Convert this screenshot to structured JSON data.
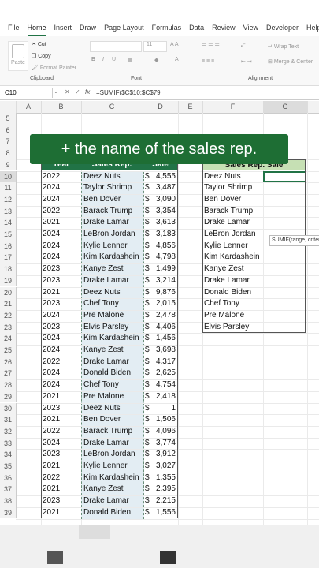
{
  "menu": [
    "File",
    "Home",
    "Insert",
    "Draw",
    "Page Layout",
    "Formulas",
    "Data",
    "Review",
    "View",
    "Developer",
    "Help"
  ],
  "ribbon": {
    "paste": "Paste",
    "cut": "Cut",
    "copy": "Copy",
    "format_painter": "Format Painter",
    "clipboard": "Clipboard",
    "font": "Font",
    "alignment": "Alignment",
    "wrap_text": "Wrap Text",
    "merge_center": "Merge & Center",
    "font_size": "11"
  },
  "formula_bar": {
    "name_box": "C10",
    "fx": "fx",
    "formula": "=SUMIF($C$10:$C$79"
  },
  "columns": [
    "A",
    "B",
    "C",
    "D",
    "E",
    "F",
    "G"
  ],
  "rows": [
    "5",
    "6",
    "7",
    "8",
    "9",
    "10",
    "11",
    "12",
    "13",
    "14",
    "15",
    "16",
    "17",
    "18",
    "19",
    "20",
    "21",
    "22",
    "23",
    "24",
    "25",
    "26",
    "27",
    "28",
    "29",
    "30",
    "31",
    "32",
    "33",
    "34",
    "35",
    "36",
    "37",
    "38",
    "39"
  ],
  "table_headers": {
    "year": "Year",
    "rep": "Sales Rep.",
    "sale": "Sale"
  },
  "table": [
    [
      "2022",
      "Deez Nuts",
      "$ 4,555"
    ],
    [
      "2024",
      "Taylor Shrimp",
      "$ 3,487"
    ],
    [
      "2024",
      "Ben Dover",
      "$ 3,090"
    ],
    [
      "2022",
      "Barack Trump",
      "$ 3,354"
    ],
    [
      "2021",
      "Drake Lamar",
      "$ 3,613"
    ],
    [
      "2024",
      "LeBron Jordan",
      "$ 3,183"
    ],
    [
      "2024",
      "Kylie Lenner",
      "$ 4,856"
    ],
    [
      "2024",
      "Kim Kardashein",
      "$ 4,798"
    ],
    [
      "2023",
      "Kanye Zest",
      "$ 1,499"
    ],
    [
      "2023",
      "Drake Lamar",
      "$ 3,214"
    ],
    [
      "2021",
      "Deez Nuts",
      "$ 9,876"
    ],
    [
      "2023",
      "Chef Tony",
      "$ 2,015"
    ],
    [
      "2024",
      "Pre Malone",
      "$ 2,478"
    ],
    [
      "2023",
      "Elvis Parsley",
      "$ 4,406"
    ],
    [
      "2024",
      "Kim Kardashein",
      "$ 1,456"
    ],
    [
      "2024",
      "Kanye Zest",
      "$ 3,698"
    ],
    [
      "2022",
      "Drake Lamar",
      "$ 4,317"
    ],
    [
      "2024",
      "Donald Biden",
      "$ 2,625"
    ],
    [
      "2024",
      "Chef Tony",
      "$ 4,754"
    ],
    [
      "2021",
      "Pre Malone",
      "$ 2,418"
    ],
    [
      "2023",
      "Deez Nuts",
      "$ 1"
    ],
    [
      "2021",
      "Ben Dover",
      "$ 1,506"
    ],
    [
      "2022",
      "Barack Trump",
      "$ 4,096"
    ],
    [
      "2024",
      "Drake Lamar",
      "$ 3,774"
    ],
    [
      "2023",
      "LeBron Jordan",
      "$ 3,912"
    ],
    [
      "2021",
      "Kylie Lenner",
      "$ 3,027"
    ],
    [
      "2022",
      "Kim Kardashein",
      "$ 1,355"
    ],
    [
      "2021",
      "Kanye Zest",
      "$ 2,395"
    ],
    [
      "2023",
      "Drake Lamar",
      "$ 2,215"
    ],
    [
      "2021",
      "Donald Biden",
      "$ 1,556"
    ]
  ],
  "summary_header": "Sales Rep. Sale",
  "summary_reps": [
    "Deez Nuts",
    "Taylor Shrimp",
    "Ben Dover",
    "Barack Trump",
    "Drake Lamar",
    "LeBron Jordan",
    "Kylie Lenner",
    "Kim Kardashein",
    "Kanye Zest",
    "Drake Lamar",
    "Donald Biden",
    "Chef Tony",
    "Pre Malone",
    "Elvis Parsley"
  ],
  "banner": "+ the name of the sales rep.",
  "tooltip": "SUMIF(range, criteria, ...",
  "colors": {
    "accent": "#217346",
    "banner": "#1e6e34",
    "selection": "#dce8f0",
    "header_green": "#c6e0b4"
  }
}
